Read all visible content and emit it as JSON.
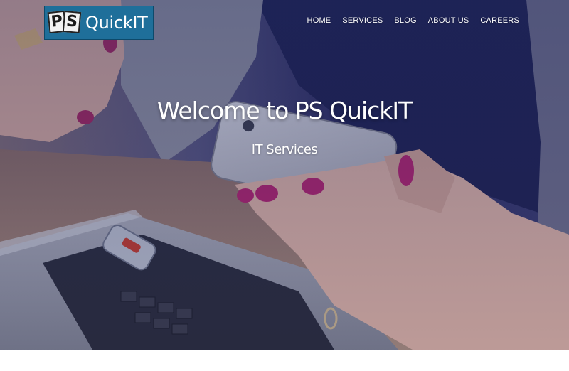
{
  "brand": {
    "logo_mark_letters": [
      "P",
      "S"
    ],
    "logo_text": "QuickIT",
    "logo_bg": "#1f6f9a"
  },
  "nav": {
    "items": [
      {
        "label": "HOME"
      },
      {
        "label": "SERVICES"
      },
      {
        "label": "BLOG"
      },
      {
        "label": "ABOUT US"
      },
      {
        "label": "CAREERS"
      }
    ]
  },
  "hero": {
    "title": "Welcome to PS QuickIT",
    "subtitle": "IT Services",
    "overlay_color": "#1c2a66"
  }
}
